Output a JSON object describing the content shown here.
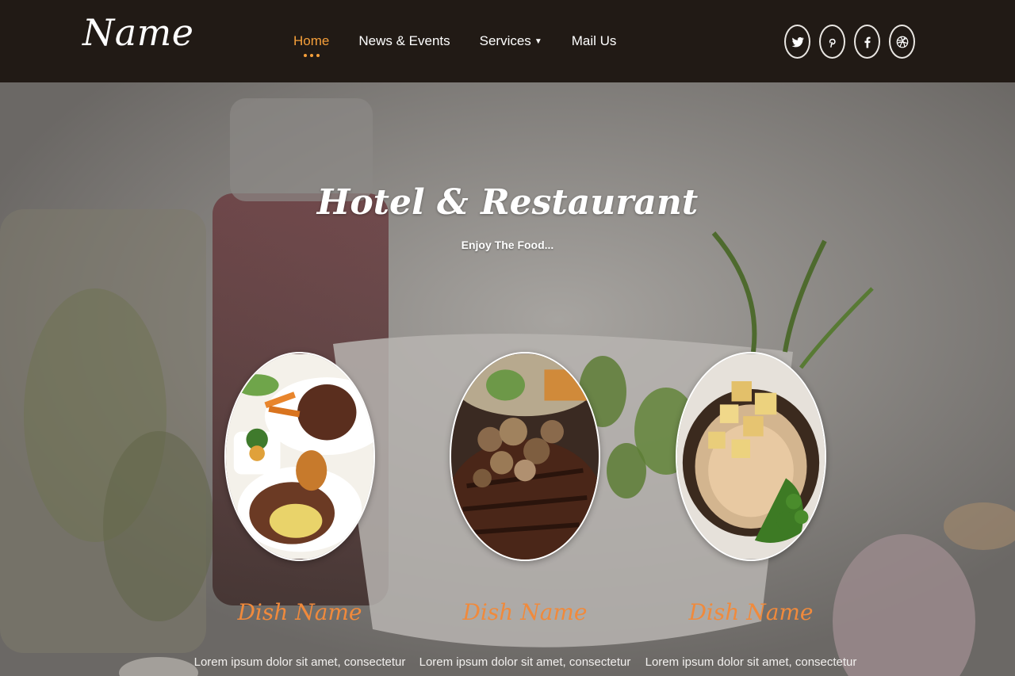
{
  "brand": {
    "logo_text": "Name"
  },
  "nav": {
    "items": [
      {
        "label": "Home",
        "active": true
      },
      {
        "label": "News & Events",
        "active": false
      },
      {
        "label": "Services",
        "active": false,
        "has_dropdown": true
      },
      {
        "label": "Mail Us",
        "active": false
      }
    ],
    "accent_color": "#f59f3a"
  },
  "socials": [
    {
      "icon": "twitter-icon"
    },
    {
      "icon": "pinterest-icon"
    },
    {
      "icon": "facebook-icon"
    },
    {
      "icon": "dribbble-icon"
    }
  ],
  "hero": {
    "title": "Hotel & Restaurant",
    "subtitle": "Enjoy The Food..."
  },
  "dishes": [
    {
      "name": "Dish Name",
      "description": "Lorem ipsum dolor sit amet, consectetur"
    },
    {
      "name": "Dish Name",
      "description": "Lorem ipsum dolor sit amet, consectetur"
    },
    {
      "name": "Dish Name",
      "description": "Lorem ipsum dolor sit amet, consectetur"
    }
  ],
  "colors": {
    "header_bg": "#211a15",
    "dish_name": "#f08a3c"
  }
}
